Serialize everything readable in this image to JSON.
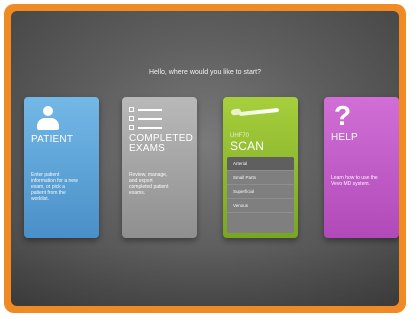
{
  "greeting": "Hello, where would you like to start?",
  "cards": [
    {
      "id": "patient",
      "title": "PATIENT",
      "description": "Enter patient\ninformation for a new\nexam, or pick a\npatient from the\nworklist.",
      "icon": "person-icon",
      "color": "#5aa3d8"
    },
    {
      "id": "completed-exams",
      "title": "COMPLETED\nEXAMS",
      "description": "Review, manage,\nand export\ncompleted patient\nexams.",
      "icon": "list-icon",
      "color": "#a6a6a6"
    },
    {
      "id": "scan",
      "model": "UHF70",
      "title": "SCAN",
      "icon": "probe-icon",
      "color": "#8fbb2e",
      "items": [
        "Arterial",
        "Small Parts",
        "Superficial",
        "Venous"
      ],
      "selected_index": 0
    },
    {
      "id": "help",
      "title": "HELP",
      "description": "Learn how to use the\nVevo MD system.",
      "icon": "question-mark-icon",
      "color": "#c25ec8"
    }
  ],
  "colors": {
    "bezel": "#f08a24",
    "screen": "#5f5f5f"
  }
}
